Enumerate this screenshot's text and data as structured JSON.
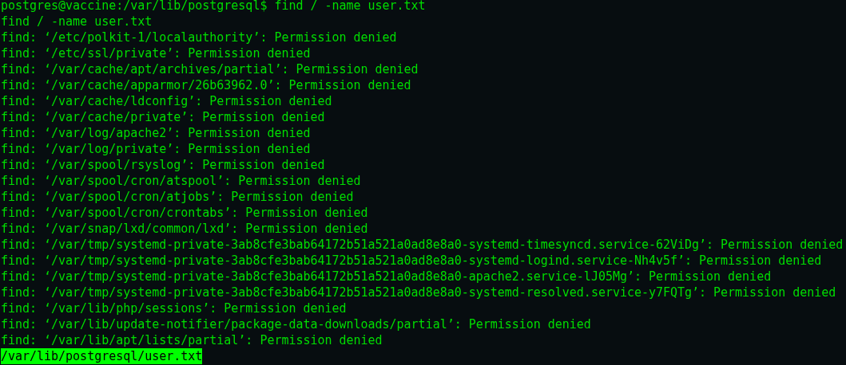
{
  "terminal": {
    "lines": [
      {
        "kind": "prompt",
        "text": "postgres@vaccine:/var/lib/postgresql$ find / -name user.txt"
      },
      {
        "kind": "output",
        "text": "find / -name user.txt"
      },
      {
        "kind": "output",
        "text": "find: ‘/etc/polkit-1/localauthority’: Permission denied"
      },
      {
        "kind": "output",
        "text": "find: ‘/etc/ssl/private’: Permission denied"
      },
      {
        "kind": "output",
        "text": "find: ‘/var/cache/apt/archives/partial’: Permission denied"
      },
      {
        "kind": "output",
        "text": "find: ‘/var/cache/apparmor/26b63962.0’: Permission denied"
      },
      {
        "kind": "output",
        "text": "find: ‘/var/cache/ldconfig’: Permission denied"
      },
      {
        "kind": "output",
        "text": "find: ‘/var/cache/private’: Permission denied"
      },
      {
        "kind": "output",
        "text": "find: ‘/var/log/apache2’: Permission denied"
      },
      {
        "kind": "output",
        "text": "find: ‘/var/log/private’: Permission denied"
      },
      {
        "kind": "output",
        "text": "find: ‘/var/spool/rsyslog’: Permission denied"
      },
      {
        "kind": "output",
        "text": "find: ‘/var/spool/cron/atspool’: Permission denied"
      },
      {
        "kind": "output",
        "text": "find: ‘/var/spool/cron/atjobs’: Permission denied"
      },
      {
        "kind": "output",
        "text": "find: ‘/var/spool/cron/crontabs’: Permission denied"
      },
      {
        "kind": "output",
        "text": "find: ‘/var/snap/lxd/common/lxd’: Permission denied"
      },
      {
        "kind": "output",
        "text": "find: ‘/var/tmp/systemd-private-3ab8cfe3bab64172b51a521a0ad8e8a0-systemd-timesyncd.service-62ViDg’: Permission denied"
      },
      {
        "kind": "output",
        "text": "find: ‘/var/tmp/systemd-private-3ab8cfe3bab64172b51a521a0ad8e8a0-systemd-logind.service-Nh4v5f’: Permission denied"
      },
      {
        "kind": "output",
        "text": "find: ‘/var/tmp/systemd-private-3ab8cfe3bab64172b51a521a0ad8e8a0-apache2.service-lJ05Mg’: Permission denied"
      },
      {
        "kind": "output",
        "text": "find: ‘/var/tmp/systemd-private-3ab8cfe3bab64172b51a521a0ad8e8a0-systemd-resolved.service-y7FQTg’: Permission denied"
      },
      {
        "kind": "output",
        "text": "find: ‘/var/lib/php/sessions’: Permission denied"
      },
      {
        "kind": "output",
        "text": "find: ‘/var/lib/update-notifier/package-data-downloads/partial’: Permission denied"
      },
      {
        "kind": "output",
        "text": "find: ‘/var/lib/apt/lists/partial’: Permission denied"
      },
      {
        "kind": "highlight",
        "text": "/var/lib/postgresql/user.txt"
      }
    ]
  }
}
